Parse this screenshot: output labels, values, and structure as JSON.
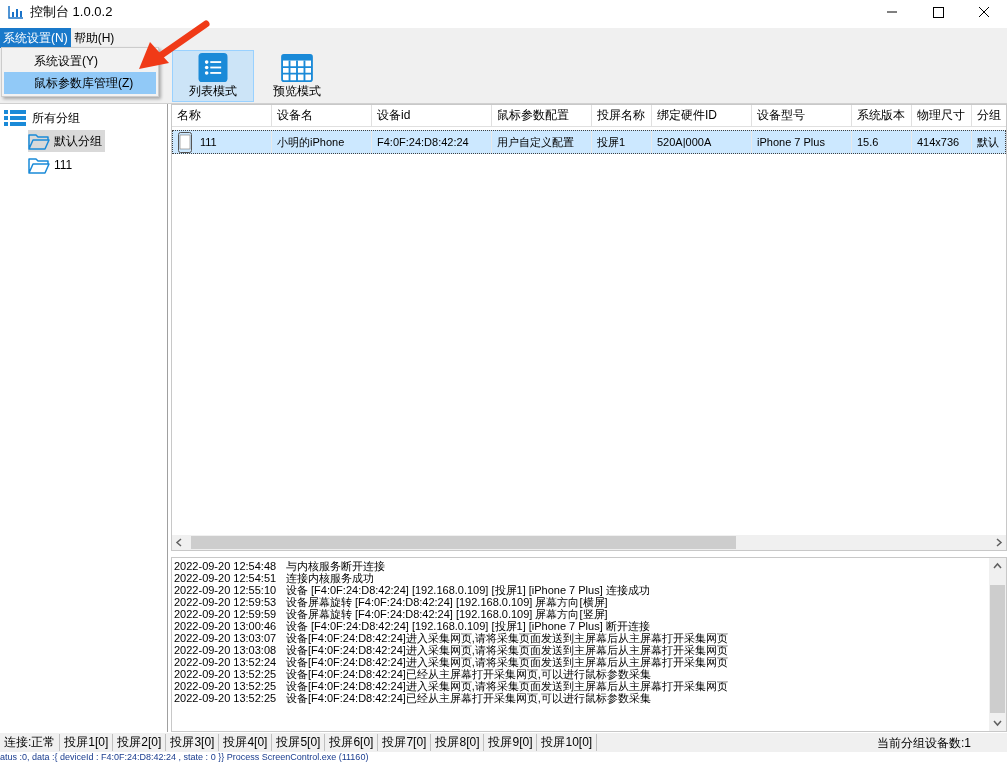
{
  "window": {
    "title": "控制台 1.0.0.2"
  },
  "menu": [
    {
      "label": "系统设置(N)",
      "selected": true
    },
    {
      "label": "帮助(H)",
      "selected": false
    }
  ],
  "dropdown": [
    {
      "label": "系统设置(Y)",
      "selected": false
    },
    {
      "label": "鼠标参数库管理(Z)",
      "selected": true
    }
  ],
  "toolbar": [
    {
      "label": "列表模式",
      "selected": true,
      "kind": "list"
    },
    {
      "label": "预览模式",
      "selected": false,
      "kind": "grid"
    }
  ],
  "tree": {
    "label": "所有分组",
    "children": [
      {
        "label": "默认分组",
        "selected": true
      },
      {
        "label": "111",
        "selected": false
      }
    ]
  },
  "table": {
    "columns": [
      "名称",
      "设备名",
      "设备id",
      "鼠标参数配置",
      "投屏名称",
      "绑定硬件ID",
      "设备型号",
      "系统版本",
      "物理尺寸",
      "分组"
    ],
    "rows": [
      {
        "selected": true,
        "cells": [
          "111",
          "小明的iPhone",
          "F4:0F:24:D8:42:24",
          "用户自定义配置",
          "投屏1",
          "520A|000A",
          "iPhone 7 Plus",
          "15.6",
          "414x736",
          "默认"
        ]
      }
    ]
  },
  "log": [
    {
      "time": "2022-09-20 12:54:48",
      "message": "与内核服务断开连接"
    },
    {
      "time": "2022-09-20 12:54:51",
      "message": "连接内核服务成功"
    },
    {
      "time": "2022-09-20 12:55:10",
      "message": "设备 [F4:0F:24:D8:42:24]  [192.168.0.109]  [投屏1]  [iPhone 7 Plus]  连接成功"
    },
    {
      "time": "2022-09-20 12:59:53",
      "message": "设备屏幕旋转 [F4:0F:24:D8:42:24]  [192.168.0.109] 屏幕方向[横屏]"
    },
    {
      "time": "2022-09-20 12:59:59",
      "message": "设备屏幕旋转 [F4:0F:24:D8:42:24]  [192.168.0.109] 屏幕方向[竖屏]"
    },
    {
      "time": "2022-09-20 13:00:46",
      "message": "设备 [F4:0F:24:D8:42:24]  [192.168.0.109]  [投屏1]  [iPhone 7 Plus]  断开连接"
    },
    {
      "time": "2022-09-20 13:03:07",
      "message": "设备[F4:0F:24:D8:42:24]进入采集网页,请将采集页面发送到主屏幕后从主屏幕打开采集网页"
    },
    {
      "time": "2022-09-20 13:03:08",
      "message": "设备[F4:0F:24:D8:42:24]进入采集网页,请将采集页面发送到主屏幕后从主屏幕打开采集网页"
    },
    {
      "time": "2022-09-20 13:52:24",
      "message": "设备[F4:0F:24:D8:42:24]进入采集网页,请将采集页面发送到主屏幕后从主屏幕打开采集网页"
    },
    {
      "time": "2022-09-20 13:52:25",
      "message": "设备[F4:0F:24:D8:42:24]已经从主屏幕打开采集网页,可以进行鼠标参数采集"
    },
    {
      "time": "2022-09-20 13:52:25",
      "message": "设备[F4:0F:24:D8:42:24]进入采集网页,请将采集页面发送到主屏幕后从主屏幕打开采集网页"
    },
    {
      "time": "2022-09-20 13:52:25",
      "message": "设备[F4:0F:24:D8:42:24]已经从主屏幕打开采集网页,可以进行鼠标参数采集"
    }
  ],
  "status_bar": {
    "items": [
      "连接:正常",
      "投屏1[0]",
      "投屏2[0]",
      "投屏3[0]",
      "投屏4[0]",
      "投屏5[0]",
      "投屏6[0]",
      "投屏7[0]",
      "投屏8[0]",
      "投屏9[0]",
      "投屏10[0]"
    ],
    "device_count": "当前分组设备数:1"
  },
  "background_text": "atus :0, data :{ deviceId : F4:0F:24:D8:42:24 , state : 0 }}   Process ScreenControl.exe (11160)"
}
